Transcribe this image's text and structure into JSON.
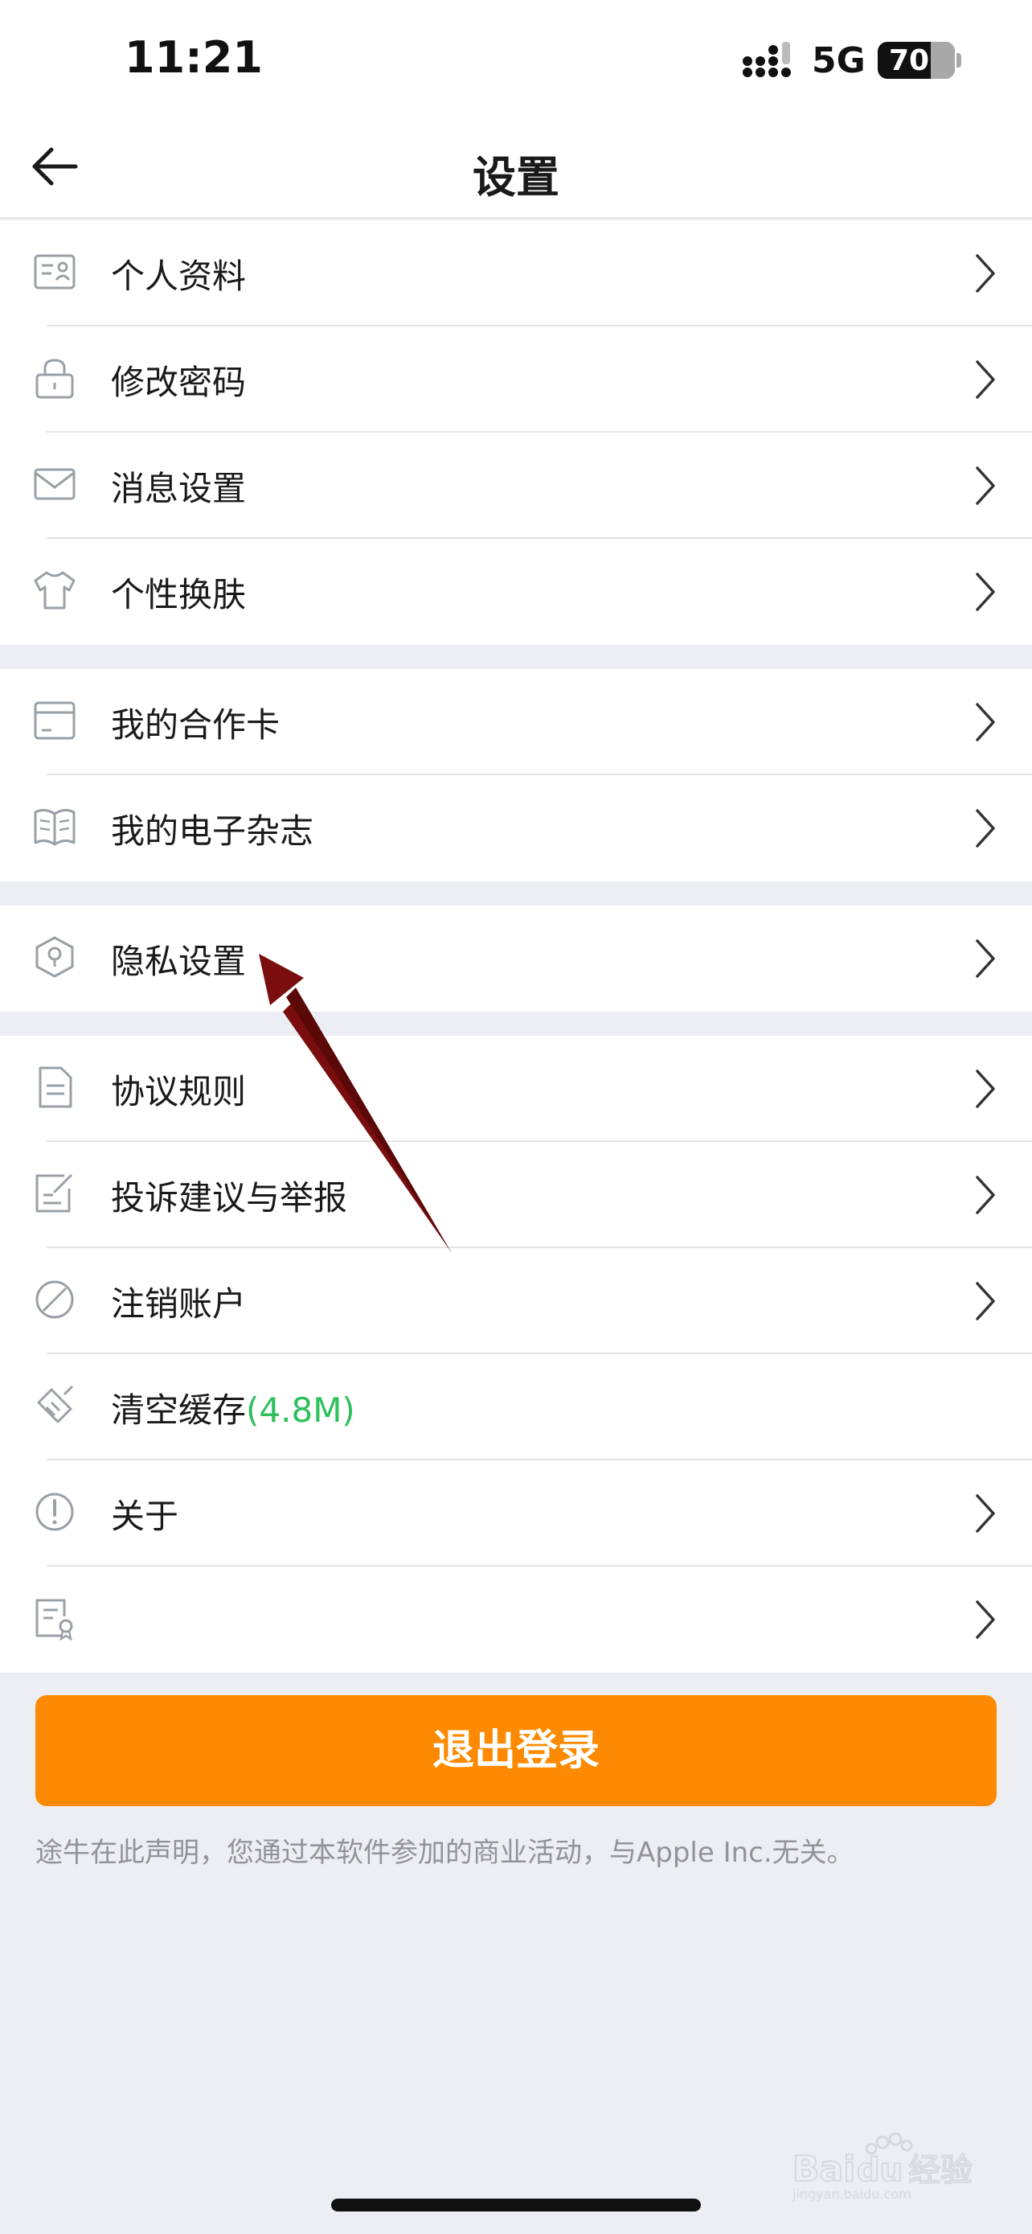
{
  "status_bar": {
    "time": "11:21",
    "network": "5G",
    "battery": "70"
  },
  "header": {
    "title": "设置"
  },
  "groups": [
    {
      "items": [
        {
          "label": "个人资料",
          "icon": "id-card-icon"
        },
        {
          "label": "修改密码",
          "icon": "lock-icon"
        },
        {
          "label": "消息设置",
          "icon": "envelope-icon"
        },
        {
          "label": "个性换肤",
          "icon": "tshirt-icon"
        }
      ]
    },
    {
      "items": [
        {
          "label": "我的合作卡",
          "icon": "card-icon"
        },
        {
          "label": "我的电子杂志",
          "icon": "book-icon"
        }
      ]
    },
    {
      "items": [
        {
          "label": "隐私设置",
          "icon": "privacy-shield-icon"
        }
      ]
    },
    {
      "items": [
        {
          "label": "协议规则",
          "icon": "document-icon"
        },
        {
          "label": "投诉建议与举报",
          "icon": "edit-icon"
        },
        {
          "label": "注销账户",
          "icon": "prohibited-icon"
        },
        {
          "label": "清空缓存",
          "value": "(4.8M)",
          "icon": "broom-icon"
        },
        {
          "label": "关于",
          "icon": "info-icon"
        },
        {
          "label": "",
          "icon": "certificate-icon"
        }
      ]
    }
  ],
  "logout_label": "退出登录",
  "disclaimer": "途牛在此声明，您通过本软件参加的商业活动，与Apple Inc.无关。",
  "watermark": {
    "brand": "Baidu",
    "product": "经验",
    "url": "jingyan.baidu.com"
  },
  "colors": {
    "accent": "#fd8a02",
    "value_green": "#2fbf5c",
    "annotation_arrow": "#7a0d0d"
  }
}
